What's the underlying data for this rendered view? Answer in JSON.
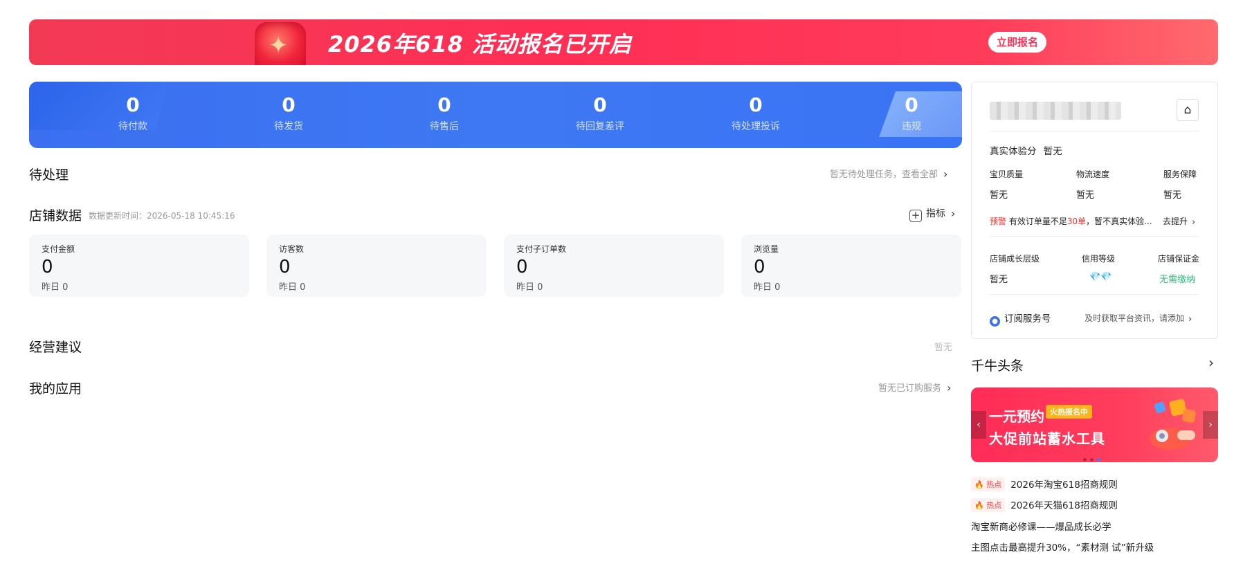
{
  "banner": {
    "title": "2026年618 活动报名已开启",
    "cta_label": "立即报名"
  },
  "stats": [
    {
      "value": "0",
      "label": "待付款"
    },
    {
      "value": "0",
      "label": "待发货"
    },
    {
      "value": "0",
      "label": "待售后"
    },
    {
      "value": "0",
      "label": "待回复差评"
    },
    {
      "value": "0",
      "label": "待处理投诉"
    },
    {
      "value": "0",
      "label": "违规"
    }
  ],
  "pending": {
    "title": "待处理",
    "link": "暂无待处理任务，查看全部"
  },
  "shop_data": {
    "title": "店铺数据",
    "update_time": "数据更新时间：2026-05-18 10:45:16",
    "metric_label": "指标",
    "cards": [
      {
        "label": "支付金额",
        "value": "0",
        "yesterday": "昨日 0"
      },
      {
        "label": "访客数",
        "value": "0",
        "yesterday": "昨日 0"
      },
      {
        "label": "支付子订单数",
        "value": "0",
        "yesterday": "昨日 0"
      },
      {
        "label": "浏览量",
        "value": "0",
        "yesterday": "昨日 0"
      }
    ]
  },
  "advice": {
    "title": "经营建议",
    "status": "暂无"
  },
  "apps": {
    "title": "我的应用",
    "link": "暂无已订购服务"
  },
  "panel": {
    "experience_label": "真实体验分",
    "experience_value": "暂无",
    "metrics": [
      {
        "label": "宝贝质量",
        "value": "暂无"
      },
      {
        "label": "物流速度",
        "value": "暂无"
      },
      {
        "label": "服务保障",
        "value": "暂无"
      }
    ],
    "warning_tag": "预警",
    "warning_pre": "有效订单量不足",
    "warning_highlight": "30单",
    "warning_post": "，暂不真实体验...",
    "warning_action": "去提升",
    "growth_label": "店铺成长层级",
    "growth_value": "暂无",
    "credit_label": "信用等级",
    "deposit_label": "店铺保证金",
    "deposit_value": "无需缴纳",
    "subscribe_label": "订阅服务号",
    "subscribe_hint": "及时获取平台资讯，请添加"
  },
  "headlines": {
    "title": "千牛头条",
    "banner_line1": "一元预约",
    "banner_tag": "火热报名中",
    "banner_line2": "大促前站蓄水工具",
    "hot_label": "热点",
    "items": [
      {
        "text": "2026年淘宝618招商规则",
        "hot": true
      },
      {
        "text": "2026年天猫618招商规则",
        "hot": true
      },
      {
        "text": "淘宝新商必修课——爆品成长必学",
        "hot": false
      },
      {
        "text": "主图点击最高提升30%，“素材测 试”新升级",
        "hot": false
      }
    ]
  },
  "colors": {
    "brand_red": "#ff2e55",
    "stats_blue": "#3e78f2",
    "deposit_green": "#2dbb7a"
  }
}
